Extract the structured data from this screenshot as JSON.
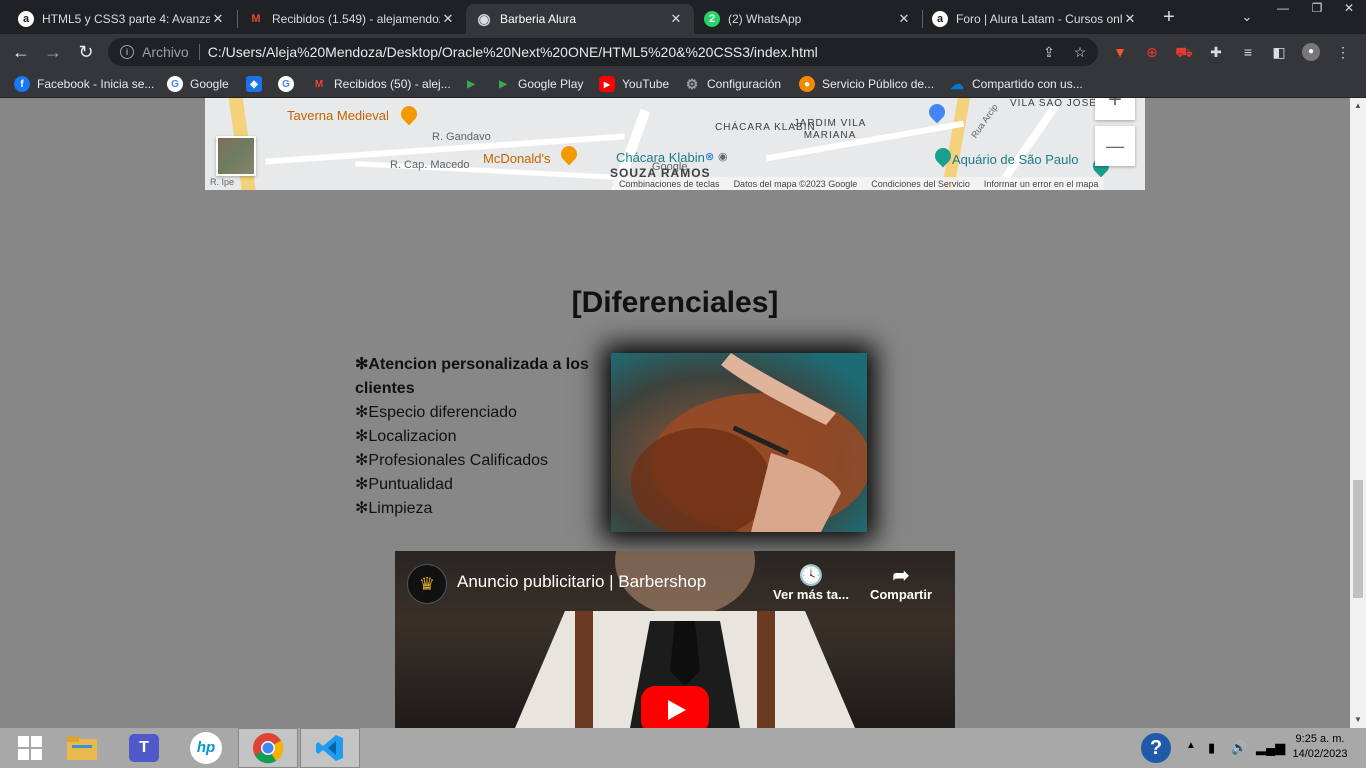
{
  "browser": {
    "tabs": [
      {
        "title": "HTML5 y CSS3 parte 4: Avanzar",
        "favicon": "a",
        "color": "#202124"
      },
      {
        "title": "Recibidos (1.549) - alejamendoz",
        "favicon": "M",
        "color": "#ea4335"
      },
      {
        "title": "Barberia Alura",
        "favicon": "◉",
        "color": "#dadce0"
      },
      {
        "title": "(2) WhatsApp",
        "favicon": "2",
        "color": "#25d366"
      },
      {
        "title": "Foro | Alura Latam - Cursos onl",
        "favicon": "a",
        "color": "#202124"
      }
    ],
    "address": {
      "scheme_label": "Archivo",
      "url": "C:/Users/Aleja%20Mendoza/Desktop/Oracle%20Next%20ONE/HTML5%20&%20CSS3/index.html"
    },
    "bookmarks": [
      {
        "label": "Facebook - Inicia se...",
        "icon": "f",
        "color": "#1877f2"
      },
      {
        "label": "Google",
        "icon": "G",
        "color": "#4285f4"
      },
      {
        "label": "",
        "icon": "◈",
        "color": "#1a73e8"
      },
      {
        "label": "",
        "icon": "G",
        "color": "#4285f4"
      },
      {
        "label": "Recibidos (50) - alej...",
        "icon": "M",
        "color": "#ea4335"
      },
      {
        "label": "",
        "icon": "▶",
        "color": "#34a853"
      },
      {
        "label": "Google Play",
        "icon": "▶",
        "color": "#34a853"
      },
      {
        "label": "YouTube",
        "icon": "▶",
        "color": "#ff0000"
      },
      {
        "label": "Configuración",
        "icon": "⚙",
        "color": "#9aa0a6"
      },
      {
        "label": "Servicio Público de...",
        "icon": "●",
        "color": "#f28b00"
      },
      {
        "label": "Compartido con us...",
        "icon": "☁",
        "color": "#0078d4"
      }
    ]
  },
  "map": {
    "labels": {
      "taverna": "Taverna Medieval",
      "gandavo": "R. Gandavo",
      "macedo": "R. Cap. Macedo",
      "ipe": "R. Ipe",
      "mcdonalds": "McDonald's",
      "chacara_klabin_area": "CHÁCARA KLABIN",
      "jardim": "JARDIM VILA MARIANA",
      "vila_sao_jose": "VILA SÃO JOSÉ",
      "chacara_klabin_station": "Chácara Klabin",
      "souza_ramos": "SOUZA RAMOS",
      "aquario": "Aquário de São Paulo",
      "rua_arcipreste": "Rua Arcip",
      "google_logo": "Google"
    },
    "attribution": [
      "Combinaciones de teclas",
      "Datos del mapa ©2023 Google",
      "Condiciones del Servicio",
      "Informar un error en el mapa"
    ],
    "zoom_in": "+",
    "zoom_out": "—"
  },
  "section": {
    "title": "[Diferenciales]",
    "features": [
      {
        "text": "✻Atencion personalizada a los clientes",
        "bold": true
      },
      {
        "text": "✻Especio diferenciado",
        "bold": false
      },
      {
        "text": "✻Localizacion",
        "bold": false
      },
      {
        "text": "✻Profesionales Calificados",
        "bold": false
      },
      {
        "text": "✻Puntualidad",
        "bold": false
      },
      {
        "text": "✻Limpieza",
        "bold": false
      }
    ]
  },
  "video": {
    "title": "Anuncio publicitario | Barbershop",
    "watch_later": "Ver más ta...",
    "share": "Compartir"
  },
  "taskbar": {
    "clock_time": "9:25 a. m.",
    "clock_date": "14/02/2023"
  }
}
